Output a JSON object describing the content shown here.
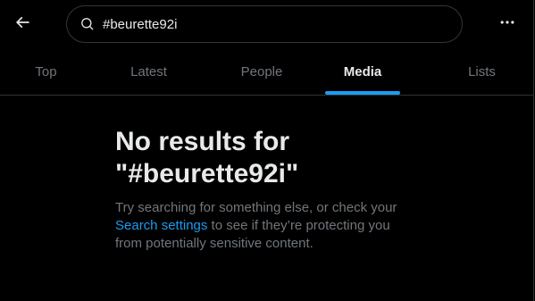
{
  "colors": {
    "background": "#000000",
    "text_primary": "#e7e9ea",
    "text_secondary": "#71767b",
    "accent": "#1d9bf0",
    "border": "#2f3336"
  },
  "header": {
    "back_icon": "arrow-left-icon",
    "search": {
      "icon": "search-icon",
      "value": "#beurette92i"
    },
    "more_icon": "more-horizontal-icon"
  },
  "tabs": [
    {
      "label": "Top",
      "active": false
    },
    {
      "label": "Latest",
      "active": false
    },
    {
      "label": "People",
      "active": false
    },
    {
      "label": "Media",
      "active": true
    },
    {
      "label": "Lists",
      "active": false
    }
  ],
  "empty_state": {
    "title_line1": "No results for",
    "title_line2": "\"#beurette92i\"",
    "body_before": "Try searching for something else, or check your",
    "link_text": "Search settings",
    "body_after": " to see if they’re protecting you from potentially sensitive content."
  }
}
